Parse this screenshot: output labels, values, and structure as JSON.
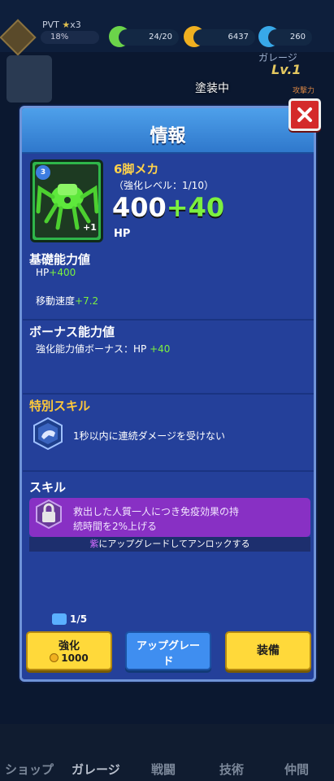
{
  "topbar": {
    "rank": "PVT",
    "rank_stars": "x3",
    "rank_progress": "18%",
    "energy": "24/20",
    "gold": "6437",
    "gems": "260"
  },
  "garage": {
    "title": "ガレージ",
    "level": "Lv.1",
    "painting_status": "塗装中",
    "side_label": "攻撃力"
  },
  "modal": {
    "title": "情報",
    "item": {
      "name": "6脚メカ",
      "level_badge": "3",
      "plus": "+1",
      "enhance_level": "（強化レベル：1/10）",
      "stat_base": "400",
      "stat_bonus": "+40",
      "stat_unit": "HP"
    },
    "base_stats": {
      "title": "基礎能力値",
      "hp_label": "HP",
      "hp_value": "+400",
      "speed_label": "移動速度",
      "speed_value": "+7.2"
    },
    "bonus_stats": {
      "title": "ボーナス能力値",
      "line_label": "強化能力値ボーナス：HP",
      "line_value": "+40"
    },
    "special_skill": {
      "title": "特別スキル",
      "text": "1秒以内に連続ダメージを受けない"
    },
    "skill": {
      "title": "スキル",
      "desc_line1": "救出した人質一人につき免疫効果の持",
      "desc_line2": "続時間を2%上げる",
      "unlock_color_word": "紫",
      "unlock_rest": "にアップグレードしてアンロックする"
    },
    "shards": "1/5",
    "buttons": {
      "enhance": "強化",
      "enhance_cost": "1000",
      "upgrade_line1": "アップグレー",
      "upgrade_line2": "ド",
      "equip": "装備"
    }
  },
  "nav": {
    "shop": "ショップ",
    "garage": "ガレージ",
    "battle": "戦闘",
    "tech": "技術",
    "friends": "仲間"
  },
  "colors": {
    "modal_bg": "#24409a",
    "header": "#3f8ee0",
    "gold_text": "#ffc93a",
    "green_bonus": "#7cf040",
    "skill_box": "#8830c4",
    "button_yellow": "#ffd93a",
    "button_blue": "#3f8ef0",
    "close_red": "#d42a2a"
  }
}
